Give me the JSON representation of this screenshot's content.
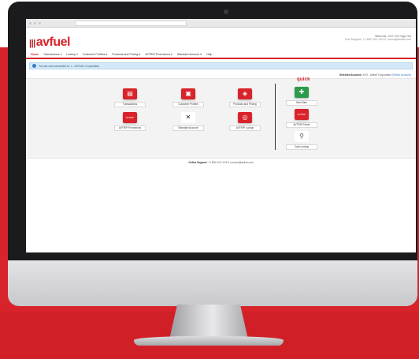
{
  "app": {
    "logo_text": "avfuel",
    "brand_mark": "pi"
  },
  "header": {
    "welcome": "Welcome, XXX XXX     Sign Out",
    "contact": "Fuel Support | +1 800 XXX XXXX | xxxxx@avfuel.com"
  },
  "nav": {
    "items": [
      "Home",
      "Transactions ▾",
      "Lookup ▾",
      "Customer Profiles ▾",
      "Products and Pricing ▾",
      "AVTRIP Promotions ▾",
      "Standard Account ▾",
      "Help"
    ]
  },
  "notice": {
    "text": "You are now connected to: 1 - AVFUEL Corporation"
  },
  "selection": {
    "label": "Selected Account:",
    "value": "XXX - Avfuel Corporation",
    "link": "(Select Account)"
  },
  "tiles": {
    "transactions": {
      "label": "Transactions",
      "icon": "transactions-icon",
      "glyph": "▤"
    },
    "customer_profiles": {
      "label": "Customer Profiles",
      "icon": "customer-profile-icon",
      "glyph": "▣"
    },
    "products_pricing": {
      "label": "Products and Pricing",
      "icon": "price-tag-icon",
      "glyph": "◈"
    },
    "avtrip_promotions": {
      "label": "AVTRIP Promotions",
      "icon": "avtrip-icon",
      "glyph": "AVTRIP"
    },
    "standard_account": {
      "label": "Standard Account",
      "icon": "tools-icon",
      "glyph": "✕"
    },
    "avtrip_lookup": {
      "label": "AVTRIP Lookup",
      "icon": "avtrip-lookup-icon",
      "glyph": "◎"
    }
  },
  "quick": {
    "title": "quick",
    "tiles": {
      "new_sale": {
        "label": "New Sale",
        "icon": "new-sale-icon",
        "glyph": "✚"
      },
      "avtrip_points": {
        "label": "AVTRIP Points",
        "icon": "avtrip-points-icon",
        "glyph": "AVTRIP"
      },
      "card_lookup": {
        "label": "Card Lookup",
        "icon": "card-lookup-icon",
        "glyph": "⚲"
      }
    }
  },
  "footer": {
    "label": "Online Support:",
    "text": "+1 800.XXX.XXXX | xxxxxx@avfuel.com"
  },
  "colors": {
    "brand_red": "#d8232a",
    "quick_green": "#2e9a4b",
    "notice_blue": "#d3e9f8"
  }
}
